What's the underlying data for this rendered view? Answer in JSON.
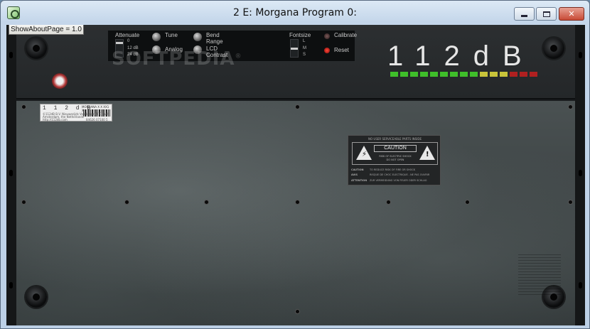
{
  "window": {
    "title": "2 E: Morgana Program 0:",
    "controls": {
      "minimize": "minimize-icon",
      "maximize": "maximize-icon",
      "close": "✕"
    }
  },
  "about_button": {
    "label": "ShowAboutPage = 1.0"
  },
  "controls": {
    "attenuate": {
      "label": "Attenuate",
      "options": [
        "0",
        "12 dB",
        "24 dB"
      ]
    },
    "tune": {
      "label": "Tune"
    },
    "analog": {
      "label": "Analog"
    },
    "bend_range": {
      "label_line1": "Bend",
      "label_line2": "Range"
    },
    "lcd_contrast": {
      "label_line1": "LCD",
      "label_line2": "Contrast"
    },
    "fontsize": {
      "label": "Fontsize",
      "options": [
        "L",
        "M",
        "S"
      ]
    },
    "calibrate": {
      "label": "Calibrate"
    },
    "reset": {
      "label": "Reset"
    }
  },
  "watermark": {
    "text": "SOFTPEDIA",
    "mark": "®"
  },
  "brand": {
    "text": "112dB"
  },
  "meter": {
    "colors": [
      "#3fbf2a",
      "#3fbf2a",
      "#3fbf2a",
      "#3fbf2a",
      "#3fbf2a",
      "#3fbf2a",
      "#3fbf2a",
      "#3fbf2a",
      "#3fbf2a",
      "#c8c43a",
      "#c8c43a",
      "#c8c43a",
      "#b02020",
      "#b02020",
      "#b02020"
    ]
  },
  "sticker": {
    "title": "1 1 2 d B",
    "code": "MORGANA X X XX1 X",
    "line1": "©112dB B.V. Nieuwezijds Voorburgwal 71 mnl.",
    "line2": "Amsterdam, the Netherlands",
    "line3": "http://112db.com",
    "barcode_num": "84626 07100 5"
  },
  "caution": {
    "header": "NO USER SERVICEABLE PARTS INSIDE",
    "title": "CAUTION",
    "sub1": "RISK OF ELECTRIC SHOCK",
    "sub2": "DO NOT OPEN",
    "rows": [
      {
        "k": "CAUTION",
        "v": "TO REDUCE RISK OF FIRE OR SHOCK"
      },
      {
        "k": "AVIS",
        "v": "RISQUE DE CHOC ELECTRIQUE - NE PAS OUVRIR"
      },
      {
        "k": "ATTENTION",
        "v": "ZUR VERMEIDUNG VON FEUER ODER SCHLAG"
      }
    ]
  }
}
